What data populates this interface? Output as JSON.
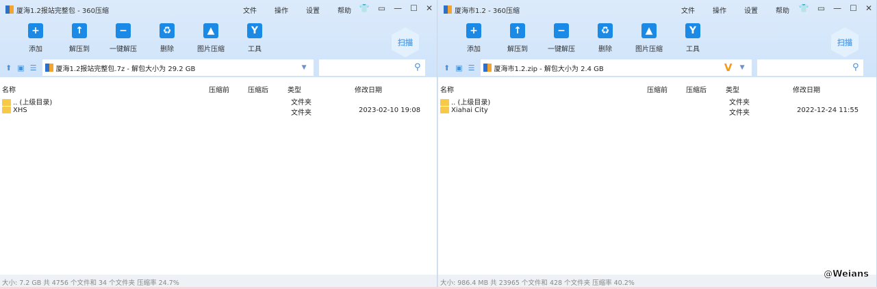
{
  "toolbar": [
    "添加",
    "解压到",
    "一键解压",
    "删除",
    "图片压缩",
    "工具"
  ],
  "tool_icons": [
    "add-icon",
    "extract-to-icon",
    "one-click-extract-icon",
    "delete-icon",
    "image-compress-icon",
    "tools-icon"
  ],
  "menu": [
    "文件",
    "操作",
    "设置",
    "帮助"
  ],
  "scan": "扫描",
  "columns": [
    "名称",
    "压缩前",
    "压缩后",
    "类型",
    "修改日期"
  ],
  "windows": [
    {
      "title": "厦海1.2报站完整包 - 360压缩",
      "path": "厦海1.2报站完整包.7z - 解包大小为 29.2 GB",
      "has_v": false,
      "rows": [
        {
          "name": ".. (上级目录)",
          "type": "文件夹",
          "date": ""
        },
        {
          "name": "XHS",
          "type": "文件夹",
          "date": "2023-02-10 19:08"
        }
      ],
      "status": "大小: 7.2 GB 共 4756 个文件和 34 个文件夹 压缩率 24.7%"
    },
    {
      "title": "厦海市1.2 - 360压缩",
      "path": "厦海市1.2.zip - 解包大小为 2.4 GB",
      "has_v": true,
      "rows": [
        {
          "name": ".. (上级目录)",
          "type": "文件夹",
          "date": ""
        },
        {
          "name": "Xiahai City",
          "type": "文件夹",
          "date": "2022-12-24 11:55"
        }
      ],
      "status": "大小: 986.4 MB 共 23965 个文件和 428 个文件夹 压缩率 40.2%"
    }
  ],
  "watermark": "@Weians"
}
